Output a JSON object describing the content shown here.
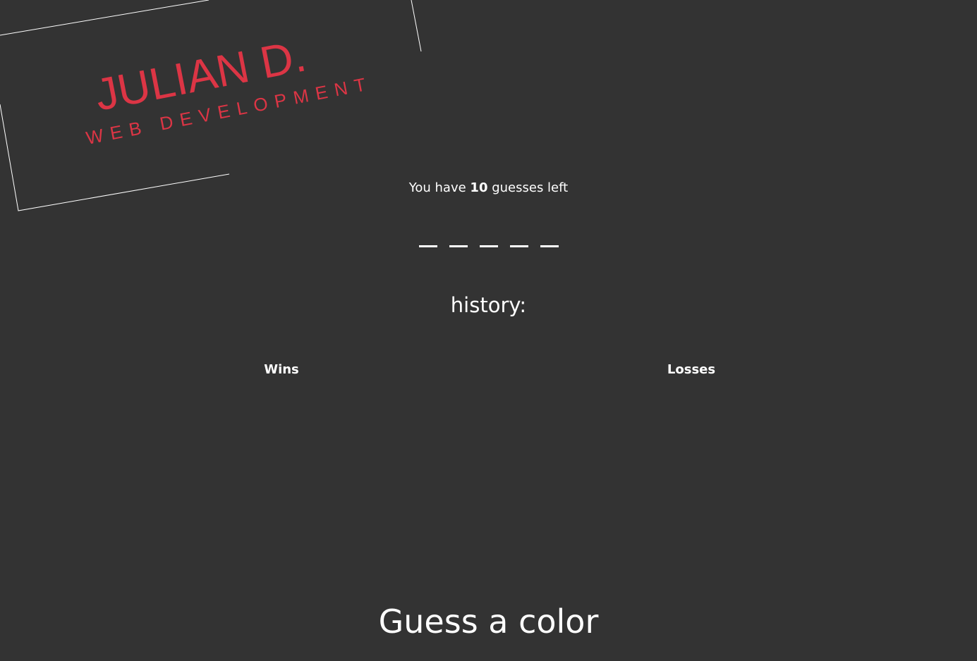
{
  "logo": {
    "name": "JULIAN D.",
    "tagline": "WEB DEVELOPMENT",
    "color": "#dc3545"
  },
  "game": {
    "guesses_prefix": "You have ",
    "guesses_left": "10",
    "guesses_suffix": " guesses left",
    "word_blanks": [
      "_",
      "_",
      "_",
      "_",
      "_"
    ]
  },
  "history": {
    "title": "history:",
    "wins_label": "Wins",
    "losses_label": "Losses"
  },
  "prompt": {
    "text": "Guess a color"
  },
  "colors": {
    "background": "#333333",
    "text": "#ffffff",
    "accent": "#dc3545"
  }
}
